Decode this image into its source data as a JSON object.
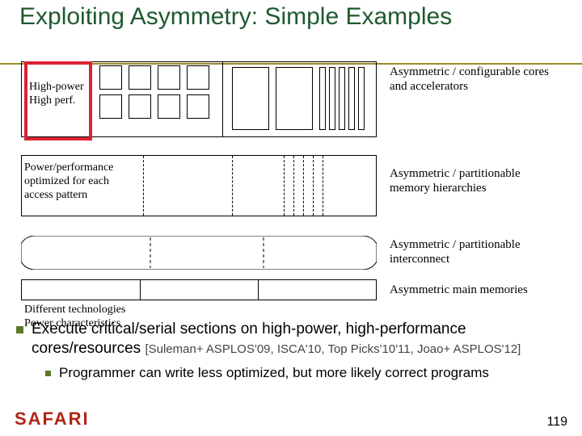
{
  "title": "Exploiting Asymmetry: Simple Examples",
  "diagram": {
    "cores": {
      "left_line1": "High-power",
      "left_line2": "High perf.",
      "right": "Asymmetric / configurable cores and accelerators"
    },
    "mem": {
      "left": "Power/performance optimized for each access pattern",
      "right": "Asymmetric / partitionable memory hierarchies"
    },
    "ic": {
      "right": "Asymmetric / partitionable interconnect"
    },
    "mm": {
      "left": "Different technologies\nPower characteristics",
      "right": "Asymmetric main memories"
    }
  },
  "bullet1": {
    "text": "Execute critical/serial sections on high-power, high-performance cores/resources",
    "refs": "[Suleman+ ASPLOS'09, ISCA'10, Top Picks'10'11, Joao+ ASPLOS'12]"
  },
  "bullet2": "Programmer can write less optimized, but more likely correct programs",
  "footer": {
    "logo": "SAFARI",
    "page": "119"
  }
}
